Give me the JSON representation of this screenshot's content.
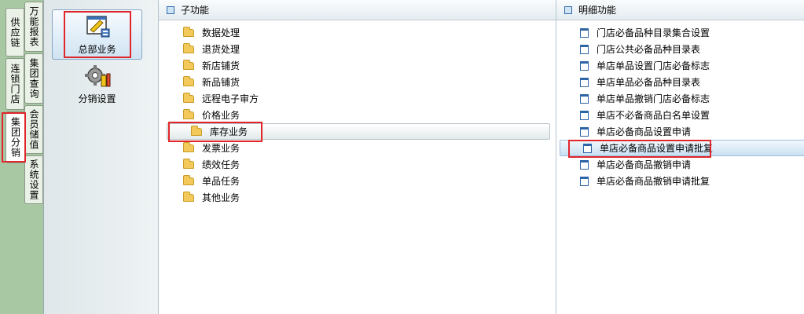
{
  "tabs": {
    "left": [
      {
        "label": "供应链"
      },
      {
        "label": "连锁门店"
      },
      {
        "label": "集团分销"
      }
    ],
    "right": [
      {
        "label": "万能报表"
      },
      {
        "label": "集团查询"
      },
      {
        "label": "会员储值"
      },
      {
        "label": "系统设置"
      }
    ]
  },
  "tools": [
    {
      "label": "总部业务",
      "icon": "headquarters-icon"
    },
    {
      "label": "分销设置",
      "icon": "gear-settings-icon"
    }
  ],
  "subfunctions": {
    "title": "子功能",
    "items": [
      {
        "label": "数据处理"
      },
      {
        "label": "退货处理"
      },
      {
        "label": "新店铺货"
      },
      {
        "label": "新品铺货"
      },
      {
        "label": "远程电子审方"
      },
      {
        "label": "价格业务"
      },
      {
        "label": "库存业务"
      },
      {
        "label": "发票业务"
      },
      {
        "label": "绩效任务"
      },
      {
        "label": "单品任务"
      },
      {
        "label": "其他业务"
      }
    ]
  },
  "details": {
    "title": "明细功能",
    "items": [
      {
        "label": "门店必备品种目录集合设置"
      },
      {
        "label": "门店公共必备品种目录表"
      },
      {
        "label": "单店单品设置门店必备标志"
      },
      {
        "label": "单店单品必备品种目录表"
      },
      {
        "label": "单店单品撤销门店必备标志"
      },
      {
        "label": "单店不必备商品白名单设置"
      },
      {
        "label": "单店必备商品设置申请"
      },
      {
        "label": "单店必备商品设置申请批复"
      },
      {
        "label": "单店必备商品撤销申请"
      },
      {
        "label": "单店必备商品撤销申请批复"
      }
    ]
  },
  "colors": {
    "highlight": "#e0262b",
    "tab_bg": "#a8c8a4"
  }
}
